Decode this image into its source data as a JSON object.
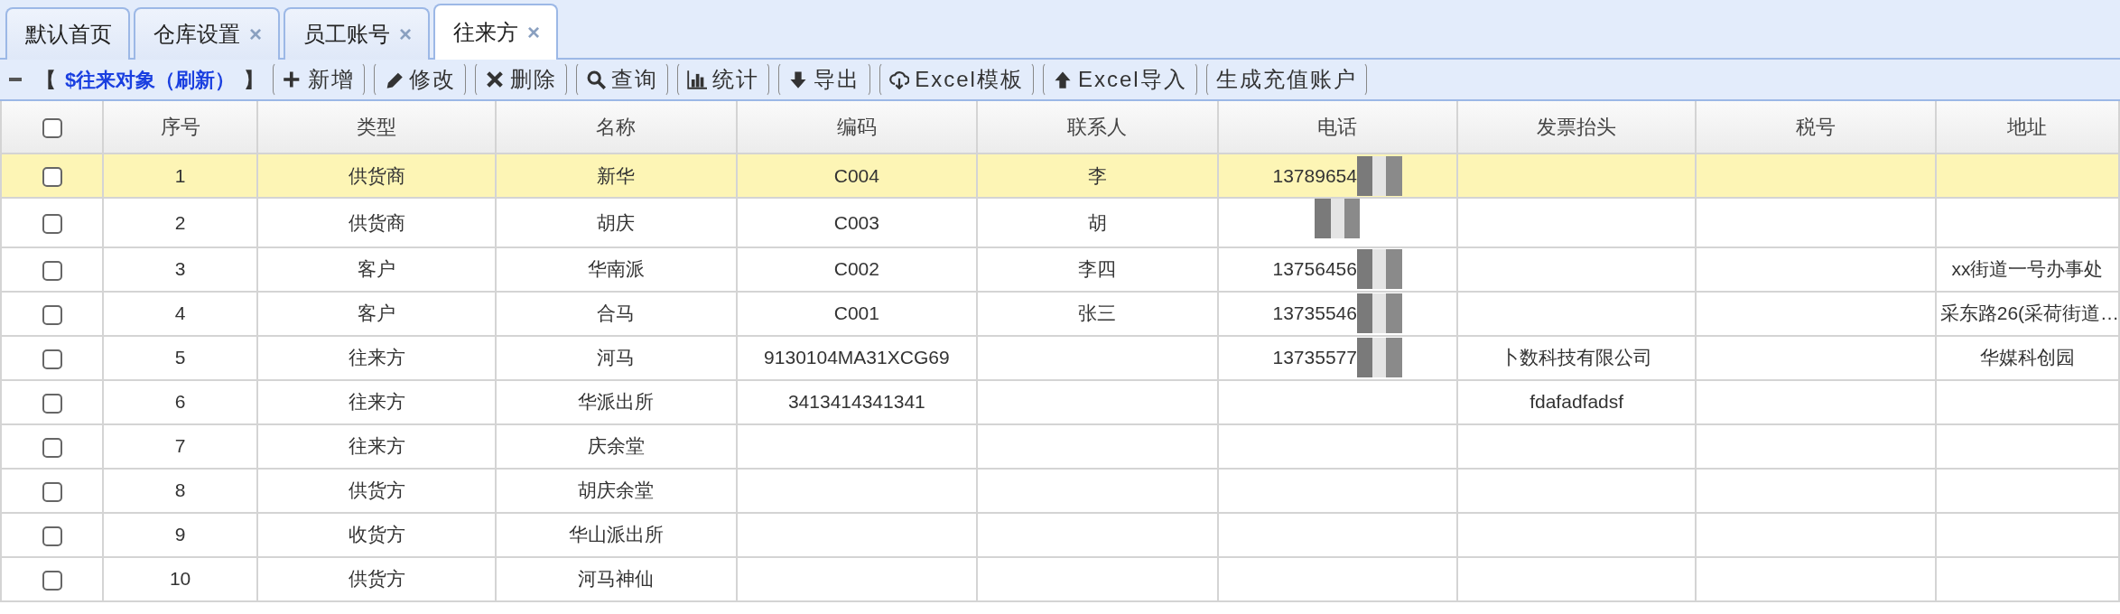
{
  "tabs": [
    {
      "label": "默认首页",
      "closable": false,
      "selected": false
    },
    {
      "label": "仓库设置",
      "closable": true,
      "selected": false
    },
    {
      "label": "员工账号",
      "closable": true,
      "selected": false
    },
    {
      "label": "往来方",
      "closable": true,
      "selected": true
    }
  ],
  "close_glyph": "×",
  "toolbar": {
    "collapsed": false,
    "bracket_open": "【",
    "title": "$往来对象（刷新）",
    "bracket_close": "】",
    "buttons": [
      {
        "kind": "add",
        "label": "新增"
      },
      {
        "kind": "edit",
        "label": "修改"
      },
      {
        "kind": "delete",
        "label": "删除"
      },
      {
        "kind": "search",
        "label": "查询"
      },
      {
        "kind": "chart",
        "label": "统计"
      },
      {
        "kind": "export",
        "label": "导出"
      },
      {
        "kind": "template",
        "label": "Excel模板"
      },
      {
        "kind": "import",
        "label": "Excel导入"
      },
      {
        "kind": "plain",
        "label": "生成充值账户"
      }
    ]
  },
  "table": {
    "select_all": false,
    "columns": [
      "序号",
      "类型",
      "名称",
      "编码",
      "联系人",
      "电话",
      "发票抬头",
      "税号",
      "地址"
    ],
    "rows": [
      {
        "selected": true,
        "checked": false,
        "masked": true,
        "cells": [
          "1",
          "供货商",
          "新华",
          "C004",
          "李",
          "13789654",
          "",
          "",
          ""
        ]
      },
      {
        "selected": false,
        "checked": false,
        "masked": true,
        "cells": [
          "2",
          "供货商",
          "胡庆",
          "C003",
          "胡",
          "",
          "",
          "",
          ""
        ]
      },
      {
        "selected": false,
        "checked": false,
        "masked": true,
        "cells": [
          "3",
          "客户",
          "华南派",
          "C002",
          "李四",
          "13756456",
          "",
          "",
          "xx街道一号办事处"
        ]
      },
      {
        "selected": false,
        "checked": false,
        "masked": true,
        "cells": [
          "4",
          "客户",
          "合马",
          "C001",
          "张三",
          "13735546",
          "",
          "",
          "采东路26(采荷街道…"
        ]
      },
      {
        "selected": false,
        "checked": false,
        "masked": true,
        "cells": [
          "5",
          "往来方",
          "河马",
          "9130104MA31XCG69",
          "",
          "13735577",
          "卜数科技有限公司",
          "",
          "华媒科创园"
        ]
      },
      {
        "selected": false,
        "checked": false,
        "masked": false,
        "cells": [
          "6",
          "往来方",
          "华派出所",
          "3413414341341",
          "",
          "",
          "fdafadfadsf",
          "",
          ""
        ]
      },
      {
        "selected": false,
        "checked": false,
        "masked": false,
        "cells": [
          "7",
          "往来方",
          "庆余堂",
          "",
          "",
          "",
          "",
          "",
          ""
        ]
      },
      {
        "selected": false,
        "checked": false,
        "masked": false,
        "cells": [
          "8",
          "供货方",
          "胡庆余堂",
          "",
          "",
          "",
          "",
          "",
          ""
        ]
      },
      {
        "selected": false,
        "checked": false,
        "masked": false,
        "cells": [
          "9",
          "收货方",
          "华山派出所",
          "",
          "",
          "",
          "",
          "",
          ""
        ]
      },
      {
        "selected": false,
        "checked": false,
        "masked": false,
        "cells": [
          "10",
          "供货方",
          "河马神仙",
          "",
          "",
          "",
          "",
          "",
          ""
        ]
      }
    ]
  }
}
